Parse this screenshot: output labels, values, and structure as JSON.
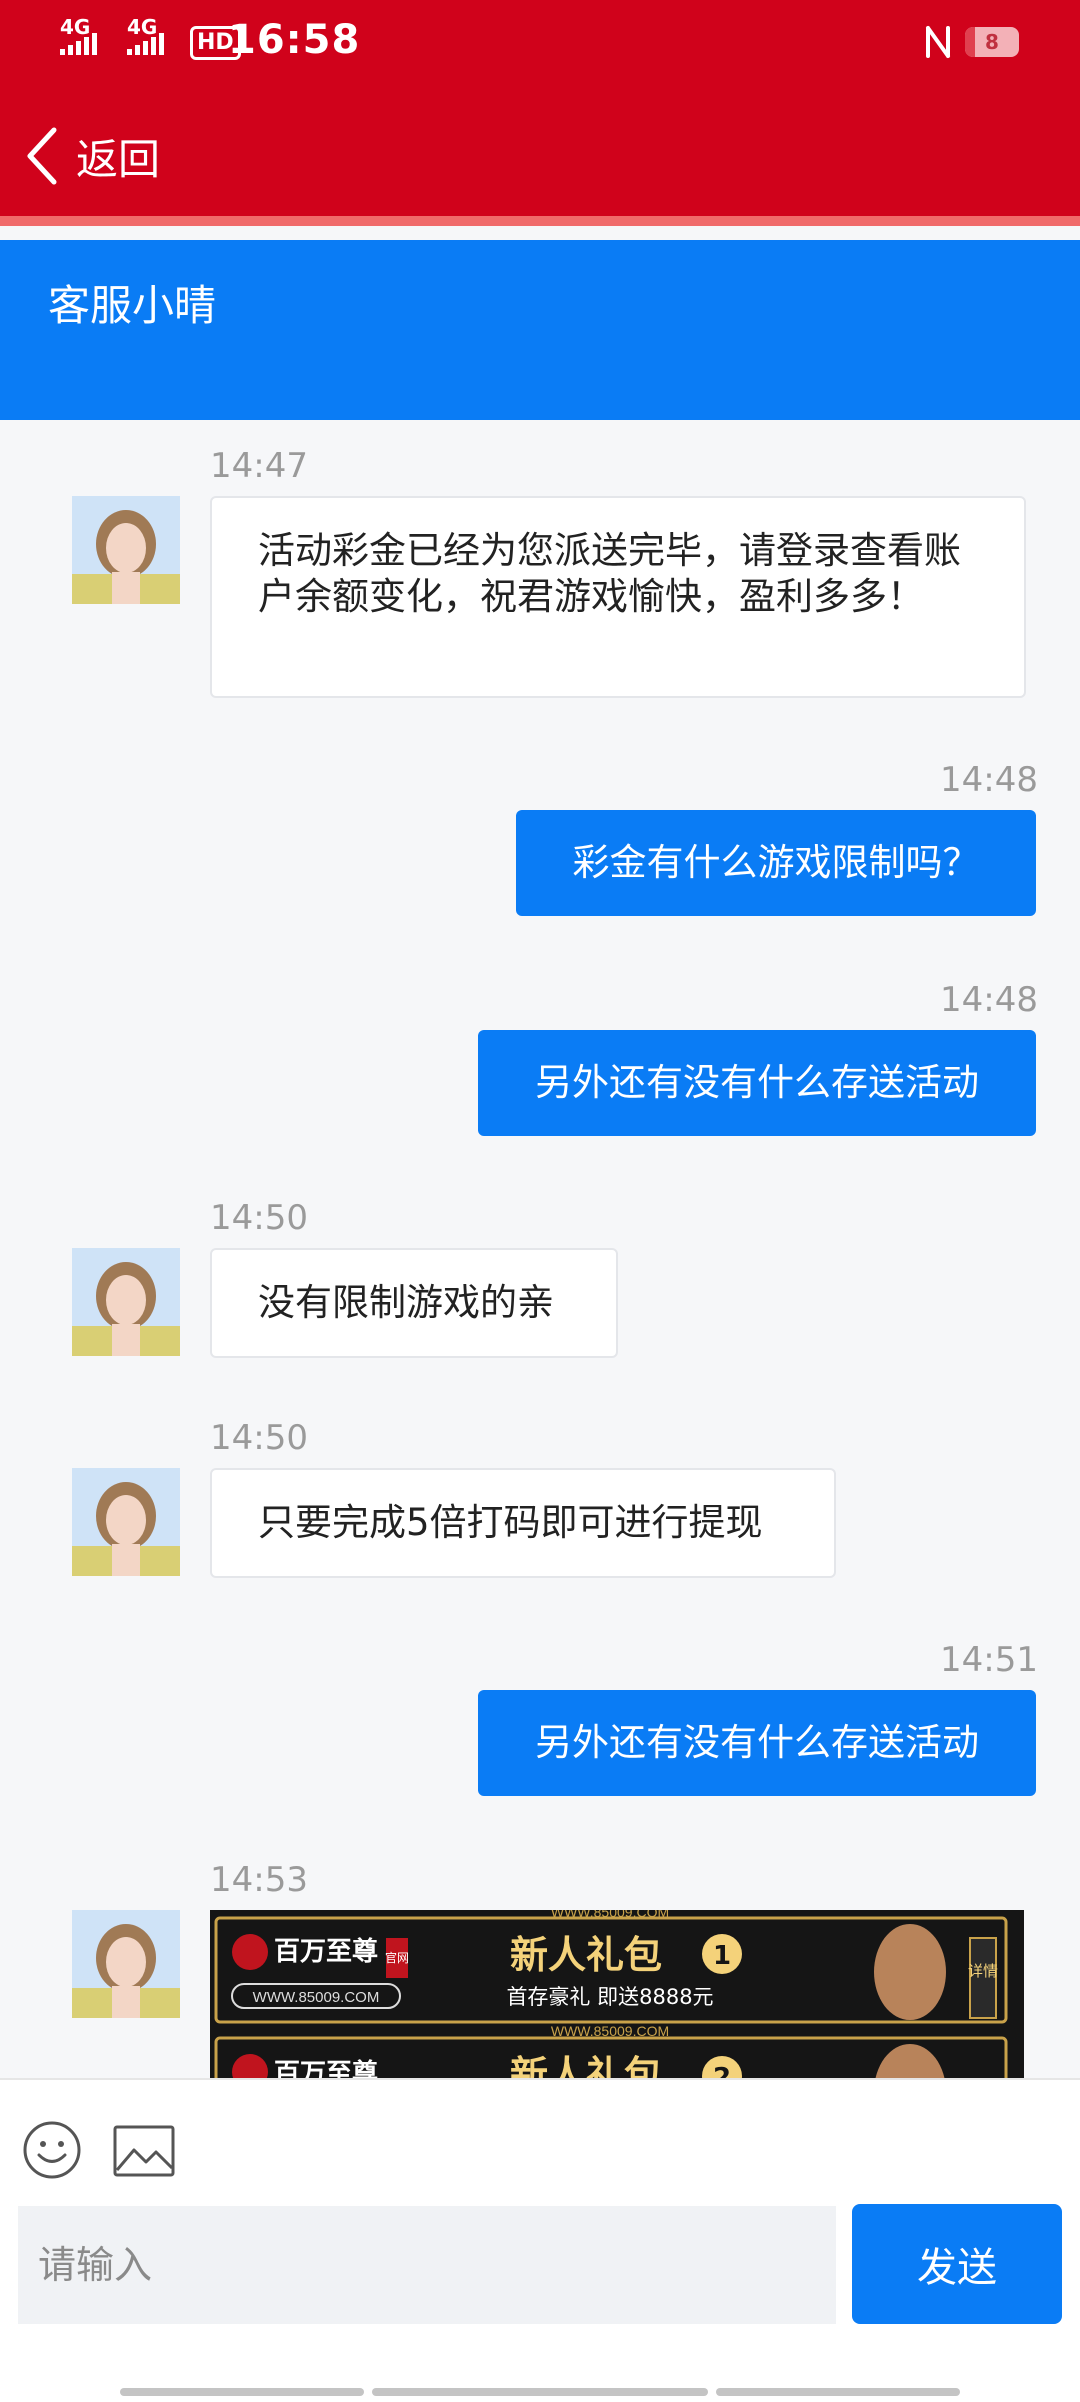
{
  "status_bar": {
    "network_1": "4G",
    "network_2": "4G",
    "hd_label": "HD",
    "time": "16:58",
    "battery_level": "8",
    "icons": [
      "signal-icon",
      "signal-icon",
      "hd-voice-icon",
      "nfc-icon",
      "battery-icon"
    ]
  },
  "header": {
    "back_label": "返回",
    "back_icon": "chevron-left-icon"
  },
  "agent": {
    "name": "客服小晴"
  },
  "colors": {
    "header_red": "#d0021b",
    "accent_blue": "#0a7cf5",
    "bubble_in": "#ffffff"
  },
  "messages": [
    {
      "direction": "in",
      "time": "14:47",
      "text": "活动彩金已经为您派送完毕，请登录查看账户余额变化，祝君游戏愉快，盈利多多！"
    },
    {
      "direction": "out",
      "time": "14:48",
      "text": "彩金有什么游戏限制吗？"
    },
    {
      "direction": "out",
      "time": "14:48",
      "text": "另外还有没有什么存送活动"
    },
    {
      "direction": "in",
      "time": "14:50",
      "text": "没有限制游戏的亲"
    },
    {
      "direction": "in",
      "time": "14:50",
      "text": "只要完成5倍打码即可进行提现"
    },
    {
      "direction": "out",
      "time": "14:51",
      "text": "另外还有没有什么存送活动"
    },
    {
      "direction": "in",
      "time": "14:53",
      "type": "image"
    }
  ],
  "promo": {
    "url_text": "WWW.85009.COM",
    "brand": "百万至尊",
    "brand_tag": "官网",
    "brand_url": "WWW.85009.COM",
    "title_1": "新人礼包",
    "badge_1": "1",
    "subtitle": "首存豪礼 即送8888元",
    "side_tag": "详情",
    "title_2": "新人礼包",
    "badge_2": "2"
  },
  "composer": {
    "placeholder": "请输入",
    "send_label": "发送",
    "emoji_icon": "smile-icon",
    "image_icon": "image-icon"
  }
}
